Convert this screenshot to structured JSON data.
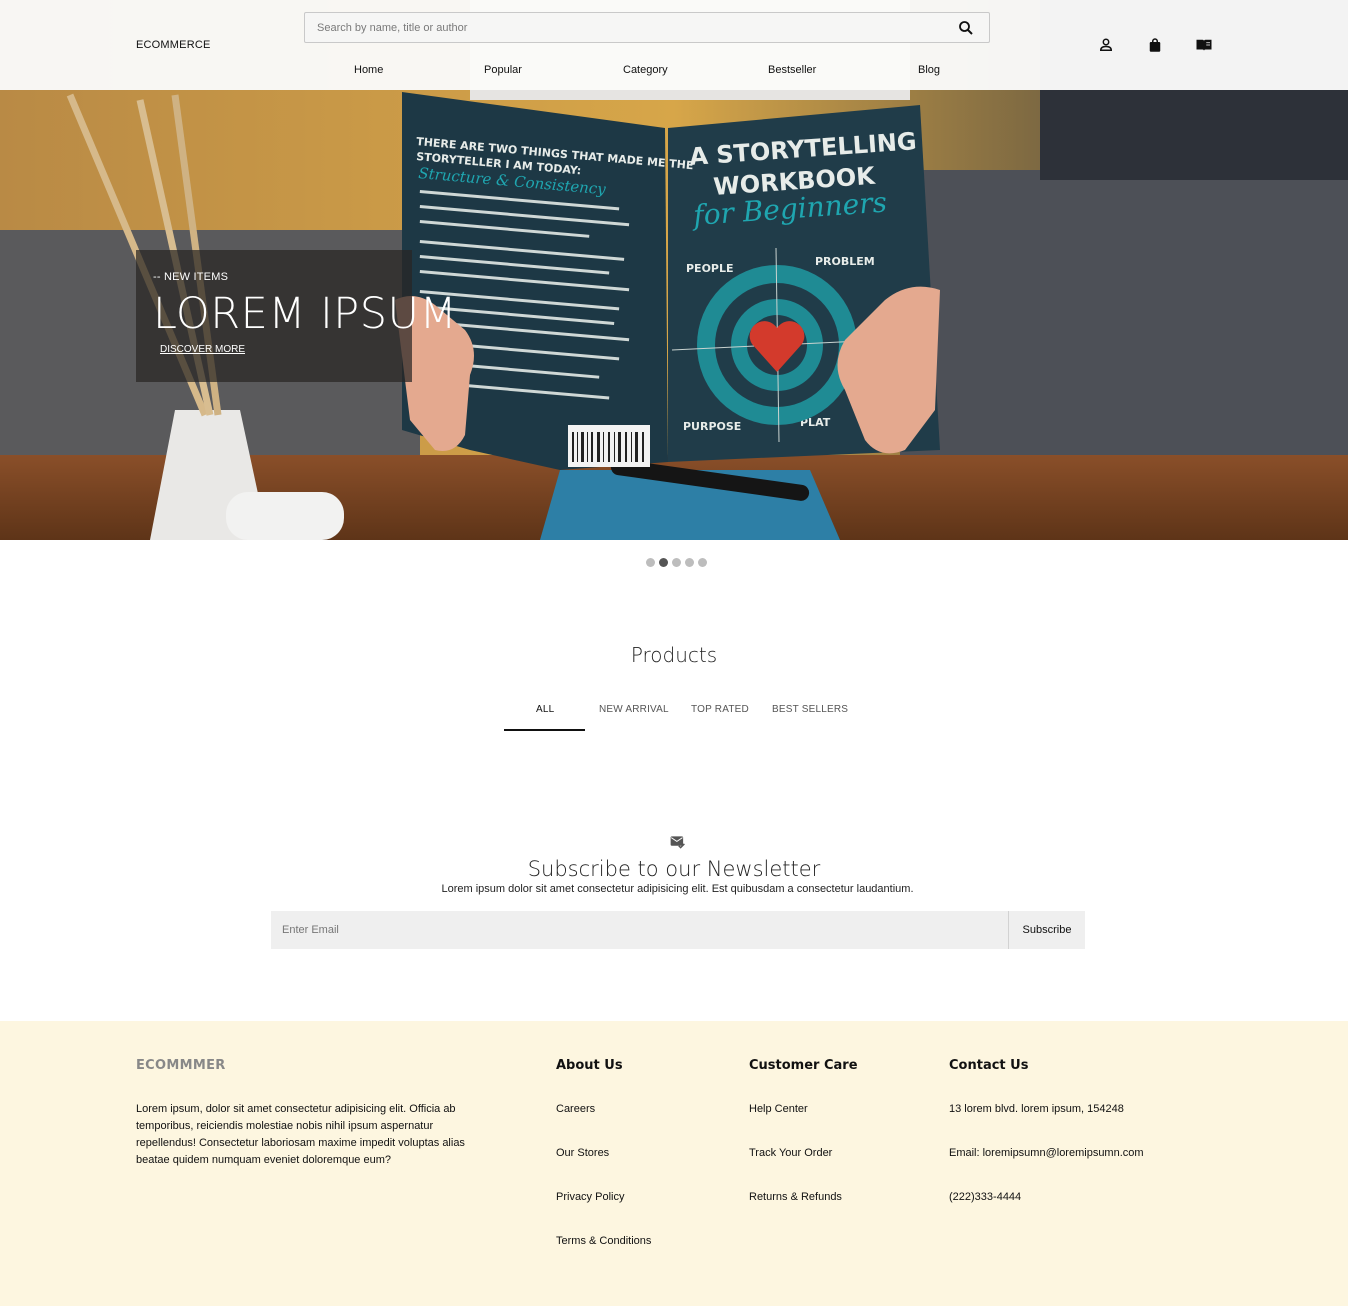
{
  "header": {
    "logo": "ECOMMERCE",
    "search_placeholder": "Search by name, title or author",
    "nav": [
      "Home",
      "Popular",
      "Category",
      "Bestseller",
      "Blog"
    ],
    "icons": [
      "search-icon",
      "user-icon",
      "shopping-bag-icon",
      "book-icon"
    ]
  },
  "hero": {
    "subtitle": "-- NEW ITEMS",
    "title": "LOREM IPSUM",
    "link": "DISCOVER MORE",
    "slides": 5,
    "active_slide": 2
  },
  "products": {
    "title": "Products",
    "tabs": [
      "ALL",
      "NEW ARRIVAL",
      "TOP RATED",
      "BEST SELLERS"
    ],
    "active_tab": "ALL"
  },
  "newsletter": {
    "icon": "mail-check-icon",
    "title": "Subscribe to our Newsletter",
    "text": "Lorem ipsum dolor sit amet consectetur adipisicing elit. Est quibusdam a consectetur laudantium.",
    "placeholder": "Enter Email",
    "button": "Subscribe"
  },
  "footer": {
    "brand": "ECOMMMER",
    "description": "Lorem ipsum, dolor sit amet consectetur adipisicing elit. Officia ab temporibus, reiciendis molestiae nobis nihil ipsum aspernatur repellendus! Consectetur laboriosam maxime impedit voluptas alias beatae quidem numquam eveniet doloremque eum?",
    "about": {
      "title": "About Us",
      "links": [
        "Careers",
        "Our Stores",
        "Privacy Policy",
        "Terms & Conditions"
      ]
    },
    "care": {
      "title": "Customer Care",
      "links": [
        "Help Center",
        "Track Your Order",
        "Returns & Refunds"
      ]
    },
    "contact": {
      "title": "Contact Us",
      "lines": [
        "13 lorem blvd. lorem ipsum, 154248",
        "Email: loremipsumn@loremipsumn.com",
        "(222)333-4444"
      ]
    }
  },
  "colors": {
    "footer_bg": "#fdf6e0",
    "accent": "#111111",
    "book_cover": "#1f3a47",
    "teal": "#1f8b94",
    "heart": "#d33a2c"
  }
}
